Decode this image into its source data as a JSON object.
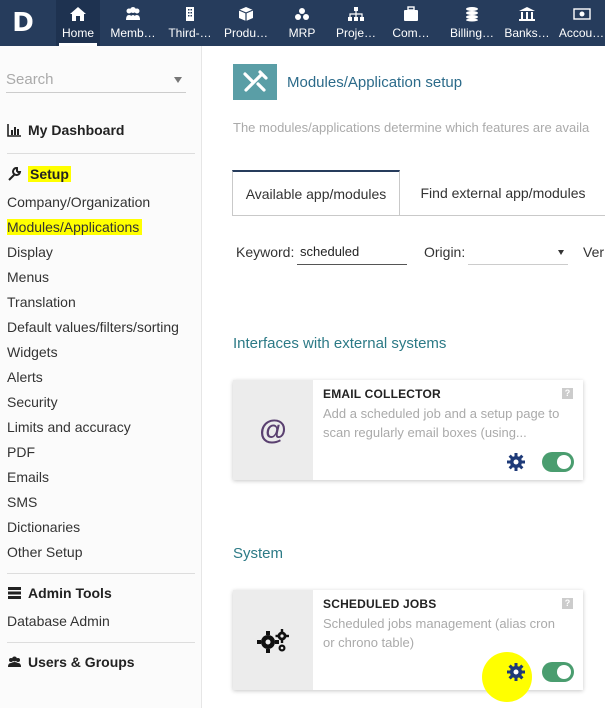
{
  "topbar": {
    "logo": "D",
    "items": [
      {
        "label": "Home",
        "icon": "home-icon"
      },
      {
        "label": "Memb…",
        "icon": "users-icon"
      },
      {
        "label": "Third-…",
        "icon": "building-icon"
      },
      {
        "label": "Produ…",
        "icon": "cube-icon"
      },
      {
        "label": "MRP",
        "icon": "cubes-icon"
      },
      {
        "label": "Proje…",
        "icon": "sitemap-icon"
      },
      {
        "label": "Com…",
        "icon": "suitcase-icon"
      },
      {
        "label": "Billing…",
        "icon": "coins-icon"
      },
      {
        "label": "Banks…",
        "icon": "bank-icon"
      },
      {
        "label": "Accou…",
        "icon": "money-icon"
      }
    ]
  },
  "sidebar": {
    "search_placeholder": "Search",
    "dashboard": "My Dashboard",
    "setup_title": "Setup",
    "setup_items": [
      "Company/Organization",
      "Modules/Applications",
      "Display",
      "Menus",
      "Translation",
      "Default values/filters/sorting",
      "Widgets",
      "Alerts",
      "Security",
      "Limits and accuracy",
      "PDF",
      "Emails",
      "SMS",
      "Dictionaries",
      "Other Setup"
    ],
    "admin_title": "Admin Tools",
    "admin_items": [
      "Database Admin"
    ],
    "users_title": "Users & Groups"
  },
  "main": {
    "title": "Modules/Application setup",
    "description": "The modules/applications determine which features are availa",
    "tabs": [
      "Available app/modules",
      "Find external app/modules"
    ],
    "filters": {
      "keyword_label": "Keyword:",
      "keyword_value": "scheduled",
      "origin_label": "Origin:",
      "version_label": "Ver"
    },
    "groups": [
      {
        "title": "Interfaces with external systems",
        "card": {
          "title": "EMAIL COLLECTOR",
          "desc": "Add a scheduled job and a setup page to scan regularly email boxes (using...",
          "icon_text": "@",
          "help": "?"
        }
      },
      {
        "title": "System",
        "card": {
          "title": "SCHEDULED JOBS",
          "desc": "Scheduled jobs management (alias cron or chrono table)",
          "help": "?"
        }
      }
    ]
  },
  "colors": {
    "topbar": "#263c5c",
    "accent_teal": "#5a9ea6",
    "toggle_on": "#4a9d6f",
    "highlight": "#ffff00",
    "gear": "#1e3a78"
  }
}
